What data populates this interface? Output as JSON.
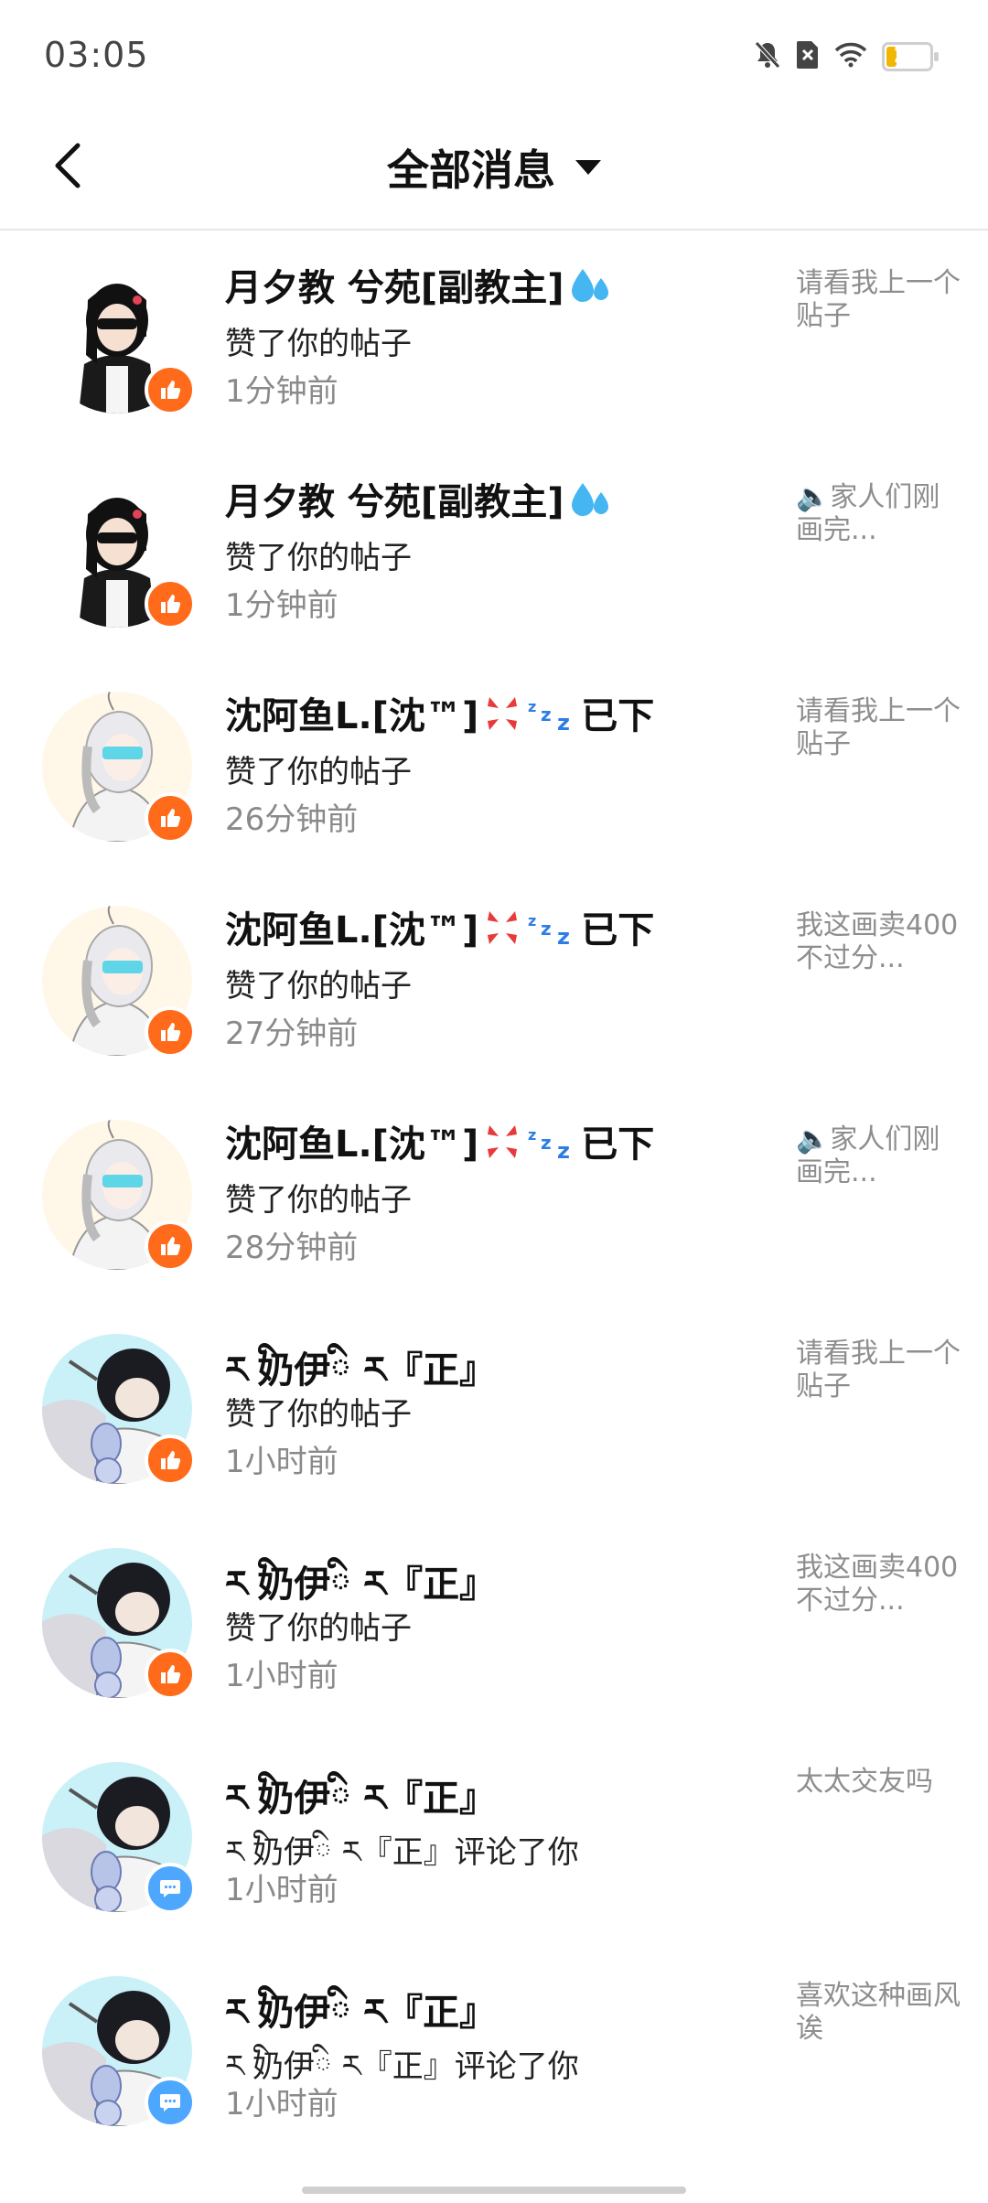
{
  "status_bar": {
    "time": "03:05",
    "battery": "21",
    "battery_level": 0.21,
    "icons": [
      "bell-off-icon",
      "sim-off-icon",
      "wifi-icon",
      "battery-icon"
    ]
  },
  "header": {
    "title": "全部消息",
    "back_icon": "chevron-left-icon",
    "dropdown_icon": "caret-down-icon"
  },
  "colors": {
    "like_badge": "#ff6b1a",
    "comment_badge": "#4ea7ff",
    "secondary_text": "#8a8a8a"
  },
  "notifications": [
    {
      "name": "月夕教  兮苑[副教主]",
      "emoji": "sweat-drops-icon",
      "action": "赞了你的帖子",
      "time": "1分钟前",
      "preview": "请看我上一个贴子",
      "type": "like",
      "avatar": "avatar-girl-sunglasses"
    },
    {
      "name": "月夕教  兮苑[副教主]",
      "emoji": "sweat-drops-icon",
      "action": "赞了你的帖子",
      "time": "1分钟前",
      "preview": "🔈家人们刚画完...",
      "type": "like",
      "avatar": "avatar-girl-sunglasses"
    },
    {
      "name": "沈阿鱼L.[沈™]",
      "emoji": "anger-zzz-icon",
      "suffix": "已下",
      "action": "赞了你的帖子",
      "time": "26分钟前",
      "preview": "请看我上一个贴子",
      "type": "like",
      "avatar": "avatar-white-hair"
    },
    {
      "name": "沈阿鱼L.[沈™]",
      "emoji": "anger-zzz-icon",
      "suffix": "已下",
      "action": "赞了你的帖子",
      "time": "27分钟前",
      "preview": "我这画卖400不过分...",
      "type": "like",
      "avatar": "avatar-white-hair"
    },
    {
      "name": "沈阿鱼L.[沈™]",
      "emoji": "anger-zzz-icon",
      "suffix": "已下",
      "action": "赞了你的帖子",
      "time": "28分钟前",
      "preview": "🔈家人们刚画完...",
      "type": "like",
      "avatar": "avatar-white-hair"
    },
    {
      "name": "ར ི奶伊ི ར『正』",
      "action": "赞了你的帖子",
      "time": "1小时前",
      "preview": "请看我上一个贴子",
      "type": "like",
      "avatar": "avatar-dark-hair"
    },
    {
      "name": "ར ི奶伊ི ར『正』",
      "action": "赞了你的帖子",
      "time": "1小时前",
      "preview": "我这画卖400不过分...",
      "type": "like",
      "avatar": "avatar-dark-hair"
    },
    {
      "name": "ར ི奶伊ི ར『正』",
      "action": "ར ི奶伊ི ར『正』评论了你",
      "time": "1小时前",
      "preview": "太太交友吗",
      "type": "comment",
      "avatar": "avatar-dark-hair"
    },
    {
      "name": "ར ི奶伊ི ར『正』",
      "action": "ར ི奶伊ི ར『正』评论了你",
      "time": "1小时前",
      "preview": "喜欢这种画风诶",
      "type": "comment",
      "avatar": "avatar-dark-hair"
    }
  ]
}
